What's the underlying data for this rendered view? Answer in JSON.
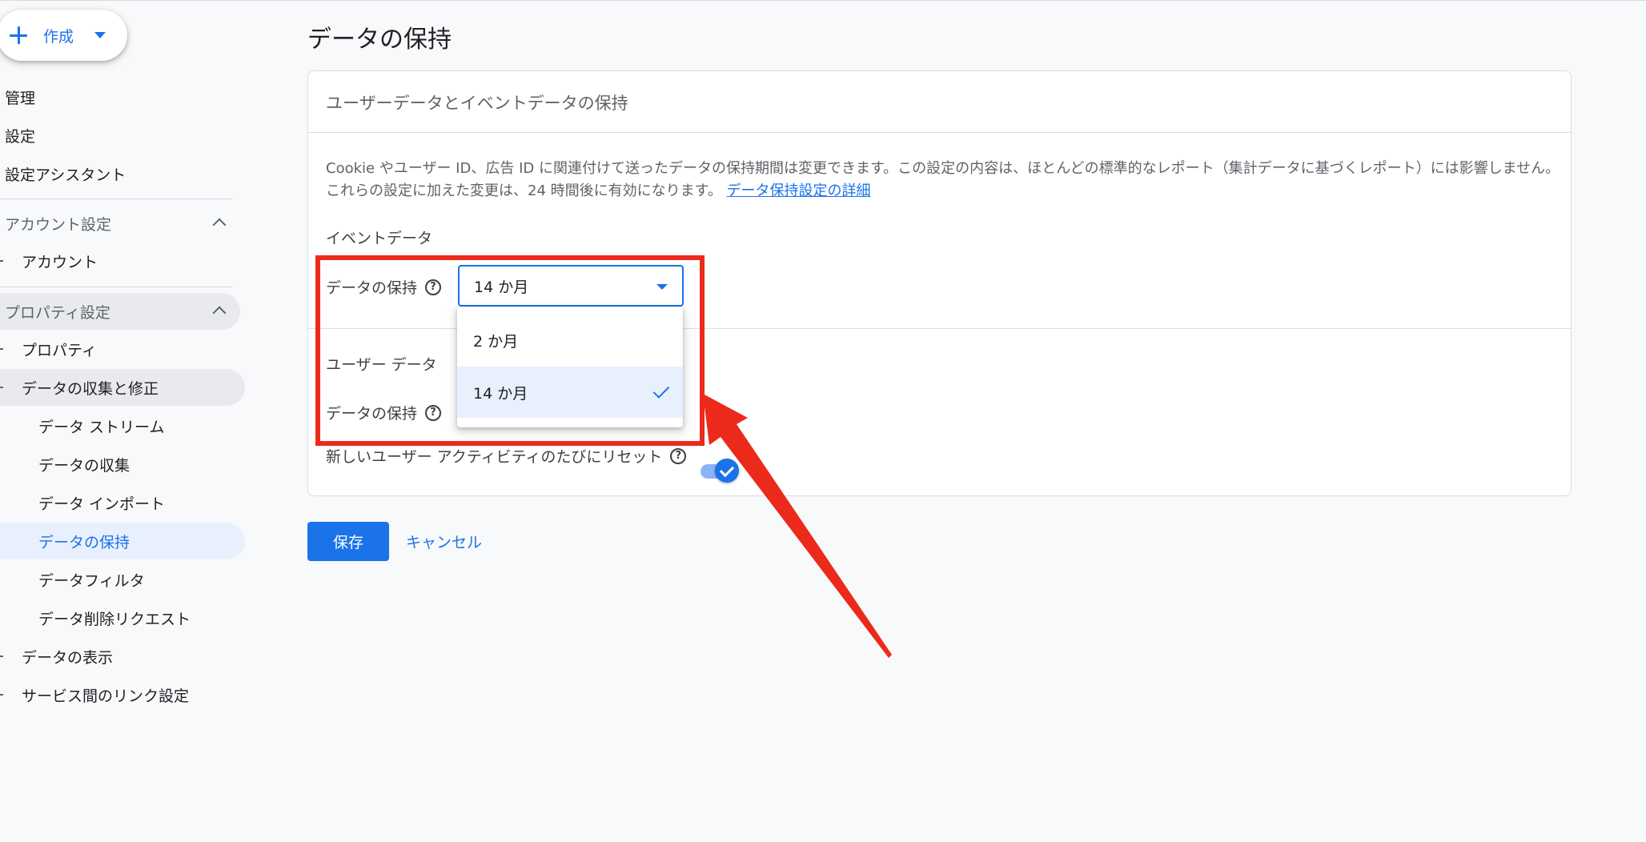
{
  "sidebar": {
    "create_label": "作成",
    "admin": "管理",
    "settings": "設定",
    "setup_assistant": "設定アシスタント",
    "account_settings": "アカウント設定",
    "account": "アカウント",
    "property_settings": "プロパティ設定",
    "property": "プロパティ",
    "data_collection_modification": "データの収集と修正",
    "data_streams": "データ ストリーム",
    "data_collection": "データの収集",
    "data_import": "データ インポート",
    "data_retention": "データの保持",
    "data_filters": "データフィルタ",
    "data_deletion_requests": "データ削除リクエスト",
    "data_display": "データの表示",
    "product_links": "サービス間のリンク設定"
  },
  "main": {
    "title": "データの保持",
    "card_title": "ユーザーデータとイベントデータの保持",
    "description": "Cookie やユーザー ID、広告 ID に関連付けて送ったデータの保持期間は変更できます。この設定の内容は、ほとんどの標準的なレポート（集計データに基づくレポート）には影響しません。これらの設定に加えた変更は、24 時間後に有効になります。",
    "learn_more_link": "データ保持設定の詳細",
    "event_data_heading": "イベントデータ",
    "event_retention_label": "データの保持",
    "event_retention_value": "14 か月",
    "user_data_heading": "ユーザー データ",
    "user_retention_label": "データの保持",
    "reset_label": "新しいユーザー アクティビティのたびにリセット",
    "reset_enabled": true,
    "help_glyph": "?"
  },
  "dropdown": {
    "options": [
      "2 か月",
      "14 か月"
    ],
    "selected": "14 か月"
  },
  "buttons": {
    "save": "保存",
    "cancel": "キャンセル"
  },
  "colors": {
    "accent": "#1a73e8",
    "annotation": "#ec2a1b",
    "background": "#f8f9fa"
  }
}
